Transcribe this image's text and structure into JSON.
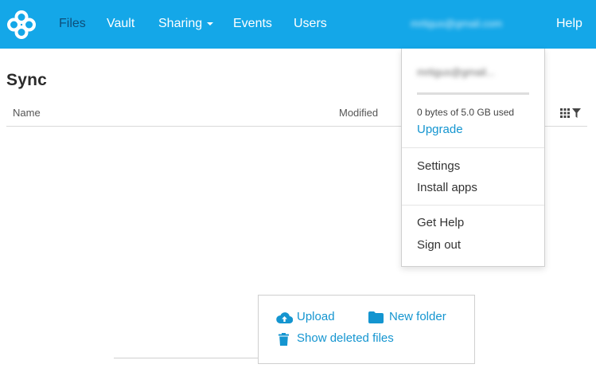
{
  "nav": {
    "items": [
      {
        "label": "Files",
        "active": true
      },
      {
        "label": "Vault"
      },
      {
        "label": "Sharing"
      },
      {
        "label": "Events"
      },
      {
        "label": "Users"
      }
    ],
    "account_email": "mrtigus@gmail.com",
    "help_label": "Help"
  },
  "page": {
    "title": "Sync",
    "columns": {
      "name": "Name",
      "modified": "Modified"
    }
  },
  "account_menu": {
    "email": "mrtigus@gmail...",
    "storage_used_fraction": 0,
    "usage_text": "0 bytes of 5.0 GB used",
    "upgrade_label": "Upgrade",
    "items_group1": [
      "Settings",
      "Install apps"
    ],
    "items_group2": [
      "Get Help",
      "Sign out"
    ]
  },
  "actions": {
    "upload": "Upload",
    "new_folder": "New folder",
    "show_deleted": "Show deleted files"
  },
  "colors": {
    "brand": "#14a7e8",
    "link": "#1495d0",
    "active_nav": "#0d4f7a"
  }
}
